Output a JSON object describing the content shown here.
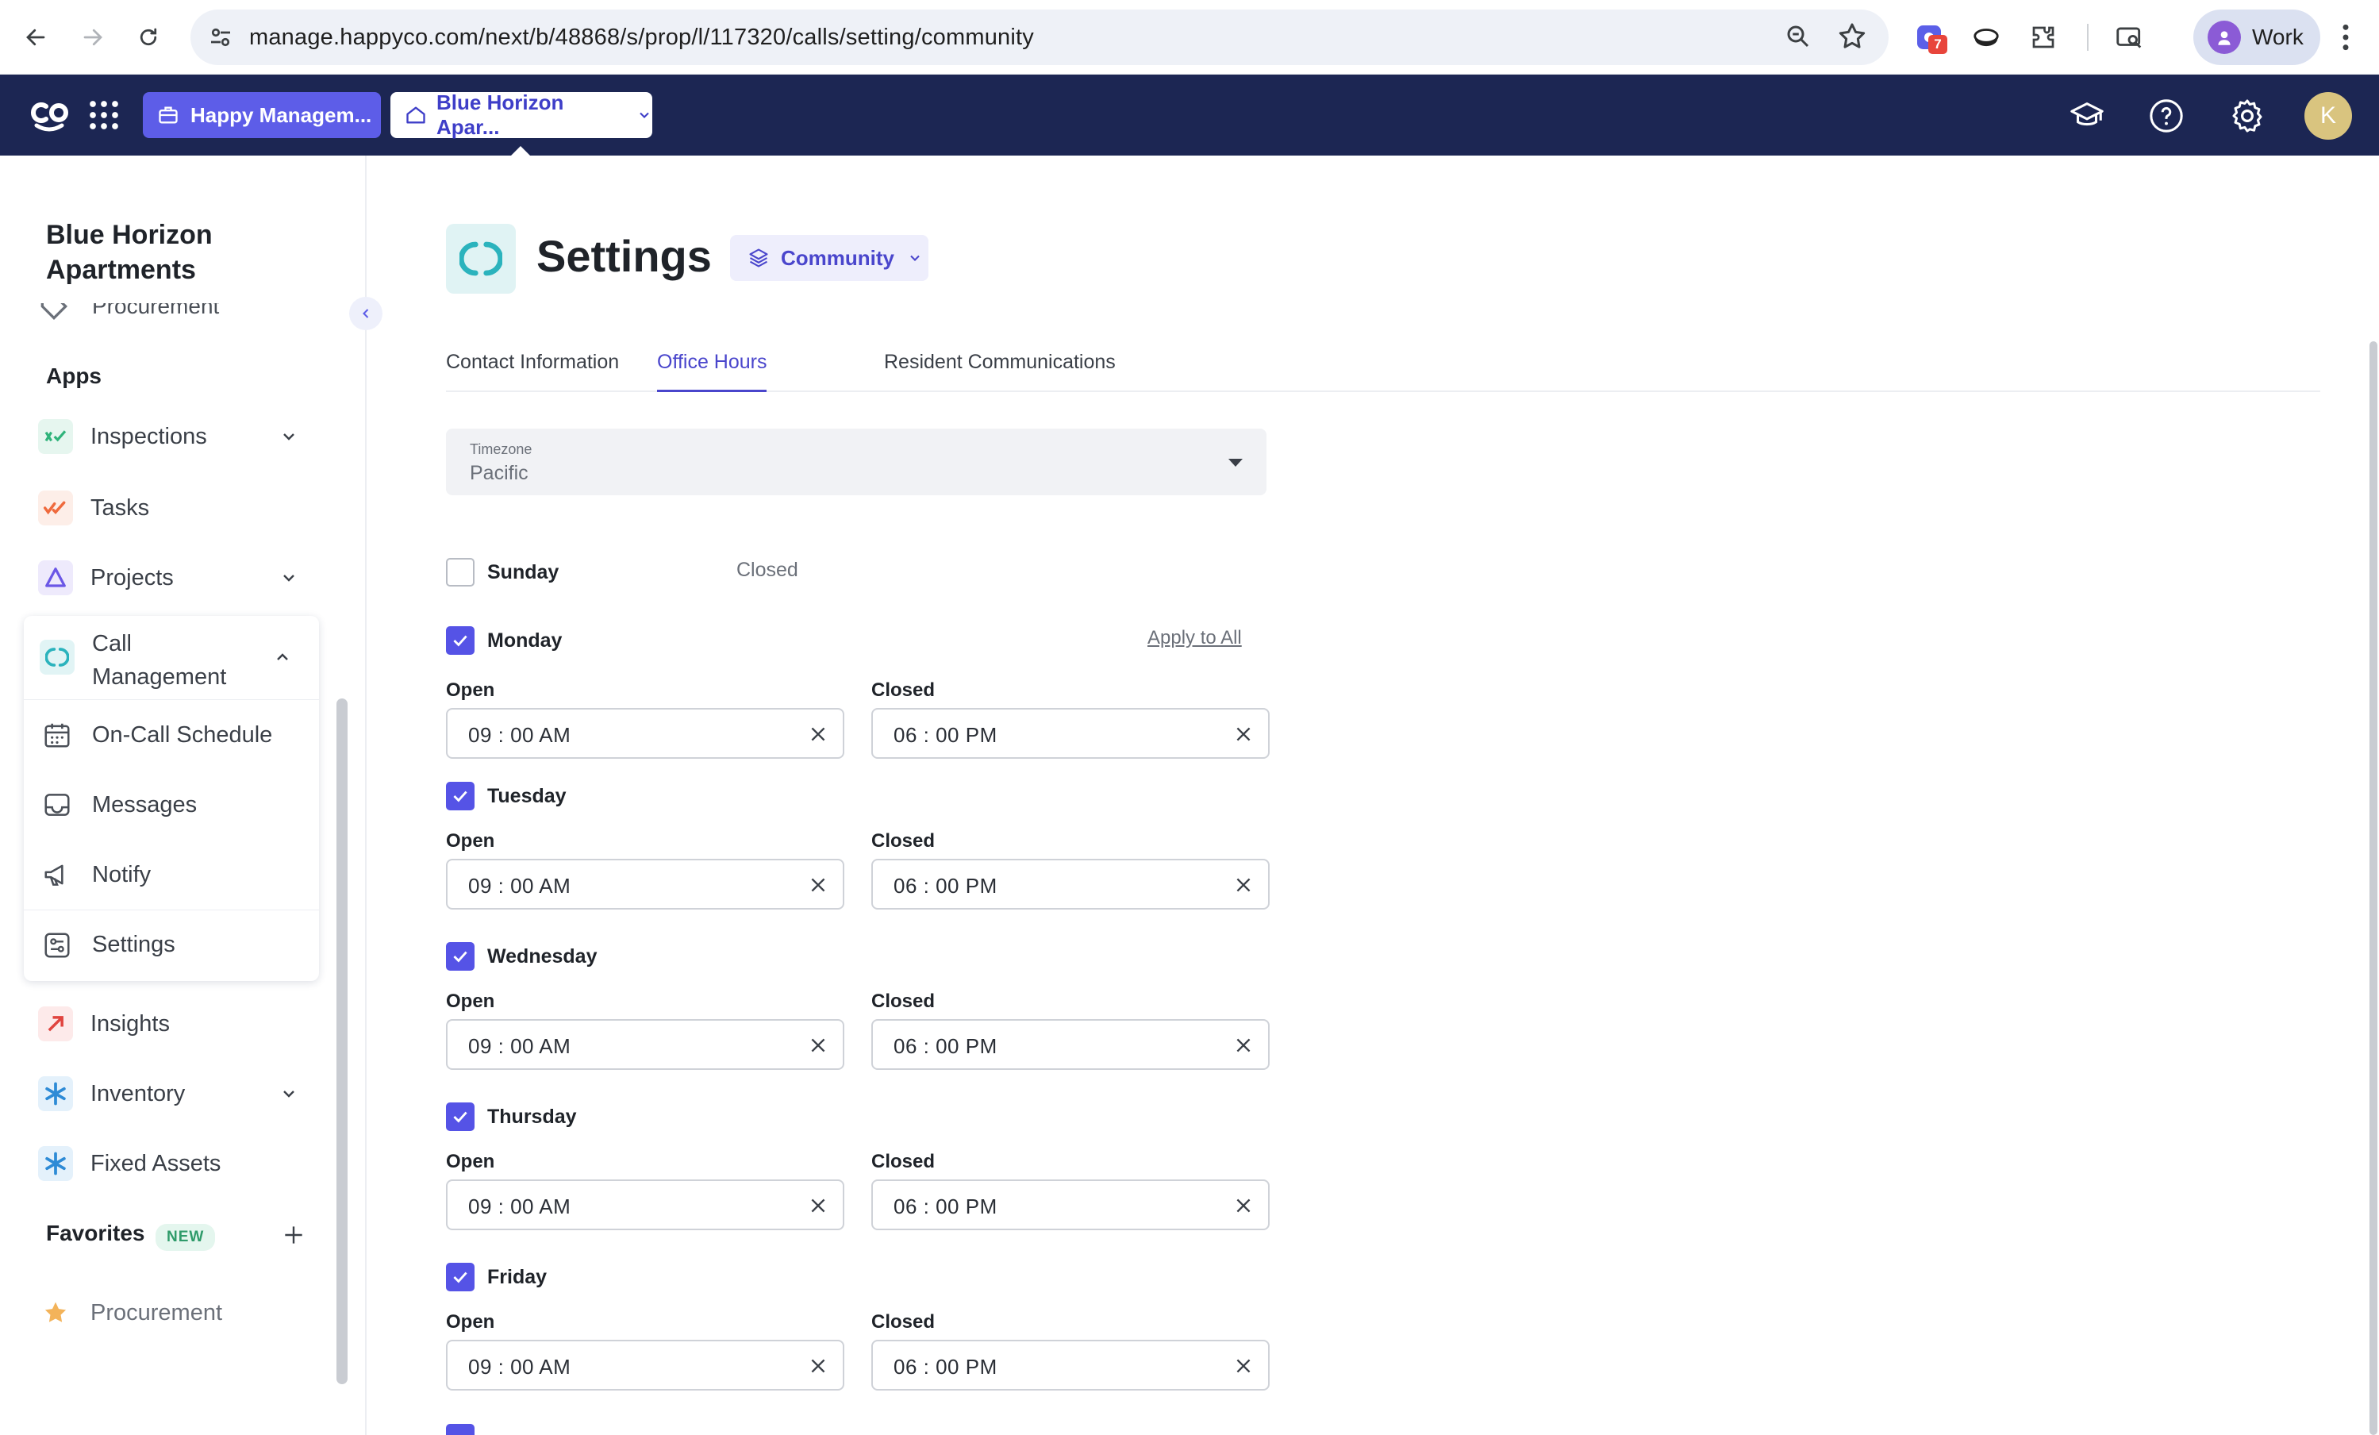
{
  "browser": {
    "url": "manage.happyco.com/next/b/48868/s/prop/l/117320/calls/setting/community",
    "extension_badge": "7",
    "profile_label": "Work"
  },
  "header": {
    "workspace_label": "Happy Managem...",
    "property_label": "Blue Horizon Apar...",
    "user_initial": "K",
    "brand_color": "#1c2653",
    "accent_color": "#5d5de8"
  },
  "sidebar": {
    "title": "Blue Horizon Apartments",
    "cut_item": "Procurement",
    "apps_label": "Apps",
    "items": [
      {
        "label": "Inspections",
        "icon": "inspections-icon"
      },
      {
        "label": "Tasks",
        "icon": "tasks-icon"
      },
      {
        "label": "Projects",
        "icon": "projects-icon"
      },
      {
        "label": "Call Management",
        "icon": "call-management-icon"
      },
      {
        "label": "Insights",
        "icon": "insights-icon"
      },
      {
        "label": "Inventory",
        "icon": "inventory-icon"
      },
      {
        "label": "Fixed Assets",
        "icon": "fixed-assets-icon"
      }
    ],
    "call_sub_items": [
      {
        "label": "On-Call Schedule",
        "icon": "calendar-icon"
      },
      {
        "label": "Messages",
        "icon": "inbox-icon"
      },
      {
        "label": "Notify",
        "icon": "megaphone-icon"
      },
      {
        "label": "Settings",
        "icon": "sliders-icon"
      }
    ],
    "favorites_label": "Favorites",
    "favorites_badge": "NEW",
    "favorites": [
      {
        "label": "Procurement",
        "icon": "star-icon"
      }
    ]
  },
  "main": {
    "title": "Settings",
    "scope_label": "Community",
    "tabs": [
      "Contact Information",
      "Office Hours",
      "Resident Communications"
    ],
    "active_tab": "Office Hours",
    "timezone": {
      "caption": "Timezone",
      "value": "Pacific"
    },
    "apply_all_label": "Apply to All",
    "open_label": "Open",
    "closed_label": "Closed",
    "days": [
      {
        "name": "Sunday",
        "checked": false,
        "status": "Closed"
      },
      {
        "name": "Monday",
        "checked": true,
        "open": "09 : 00  AM",
        "close": "06 : 00  PM"
      },
      {
        "name": "Tuesday",
        "checked": true,
        "open": "09 : 00  AM",
        "close": "06 : 00  PM"
      },
      {
        "name": "Wednesday",
        "checked": true,
        "open": "09 : 00  AM",
        "close": "06 : 00  PM"
      },
      {
        "name": "Thursday",
        "checked": true,
        "open": "09 : 00  AM",
        "close": "06 : 00  PM"
      },
      {
        "name": "Friday",
        "checked": true,
        "open": "09 : 00  AM",
        "close": "06 : 00  PM"
      }
    ]
  }
}
